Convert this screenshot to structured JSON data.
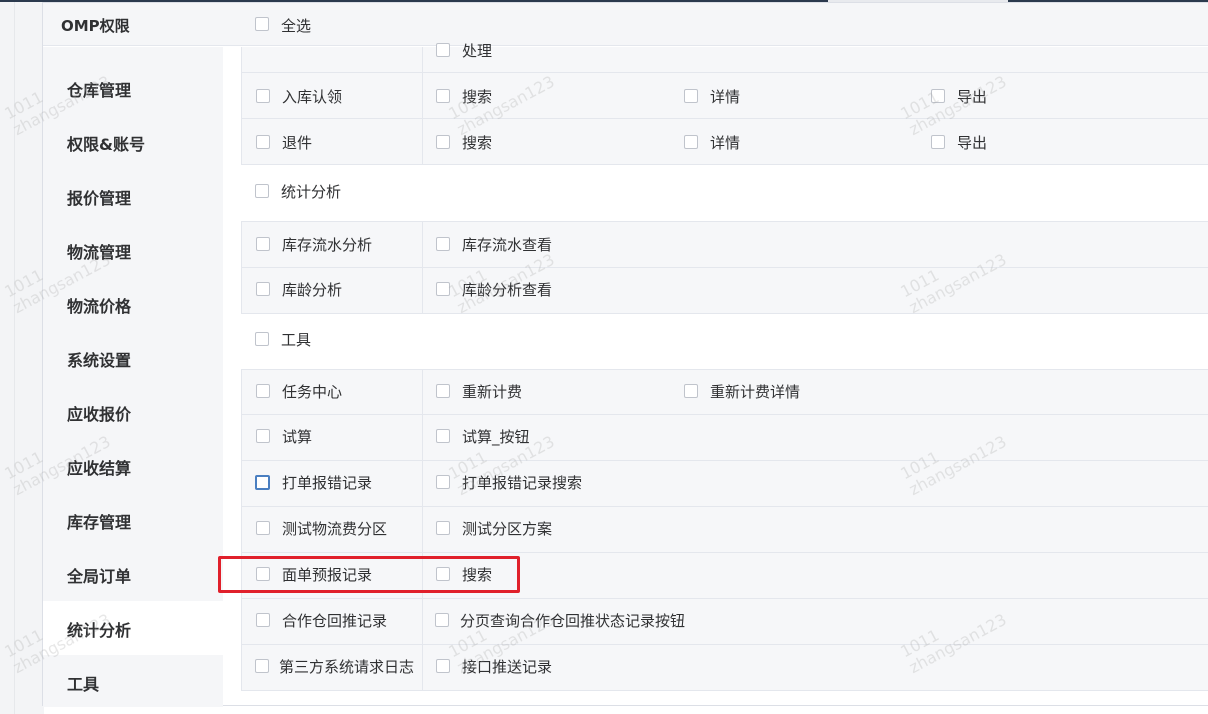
{
  "header": {
    "title": "OMP权限",
    "select_all_label": "全选"
  },
  "sidebar": {
    "items": [
      {
        "label": "仓库管理",
        "active": false
      },
      {
        "label": "权限&账号",
        "active": false
      },
      {
        "label": "报价管理",
        "active": false
      },
      {
        "label": "物流管理",
        "active": false
      },
      {
        "label": "物流价格",
        "active": false
      },
      {
        "label": "系统设置",
        "active": false
      },
      {
        "label": "应收报价",
        "active": false
      },
      {
        "label": "应收结算",
        "active": false
      },
      {
        "label": "库存管理",
        "active": false
      },
      {
        "label": "全局订单",
        "active": false
      },
      {
        "label": "统计分析",
        "active": true
      },
      {
        "label": "工具",
        "active": false
      }
    ]
  },
  "content": {
    "partial_row": {
      "action": "处理"
    },
    "rows_a": [
      {
        "name": "入库认领",
        "actions": [
          "搜索",
          "详情",
          "导出"
        ]
      },
      {
        "name": "退件",
        "actions": [
          "搜索",
          "详情",
          "导出"
        ]
      }
    ],
    "group_stats": "统计分析",
    "rows_b": [
      {
        "name": "库存流水分析",
        "actions": [
          "库存流水查看"
        ]
      },
      {
        "name": "库龄分析",
        "actions": [
          "库龄分析查看"
        ]
      }
    ],
    "group_tools": "工具",
    "rows_c": [
      {
        "name": "任务中心",
        "actions": [
          "重新计费",
          "重新计费详情"
        ]
      },
      {
        "name": "试算",
        "actions": [
          "试算_按钮"
        ]
      },
      {
        "name": "打单报错记录",
        "actions": [
          "打单报错记录搜索"
        ]
      },
      {
        "name": "测试物流费分区",
        "actions": [
          "测试分区方案"
        ]
      },
      {
        "name": "面单预报记录",
        "actions": [
          "搜索"
        ]
      },
      {
        "name": "合作仓回推记录",
        "actions": [
          "分页查询合作仓回推状态记录按钮"
        ]
      },
      {
        "name": "第三方系统请求日志",
        "actions": [
          "接口推送记录"
        ]
      }
    ]
  },
  "watermark": {
    "line1": "1011",
    "line2": "zhangsan123"
  },
  "colors": {
    "highlight_border": "#e0202b",
    "focus_border": "#4a7fc1",
    "panel_bg": "#f5f6f8"
  }
}
